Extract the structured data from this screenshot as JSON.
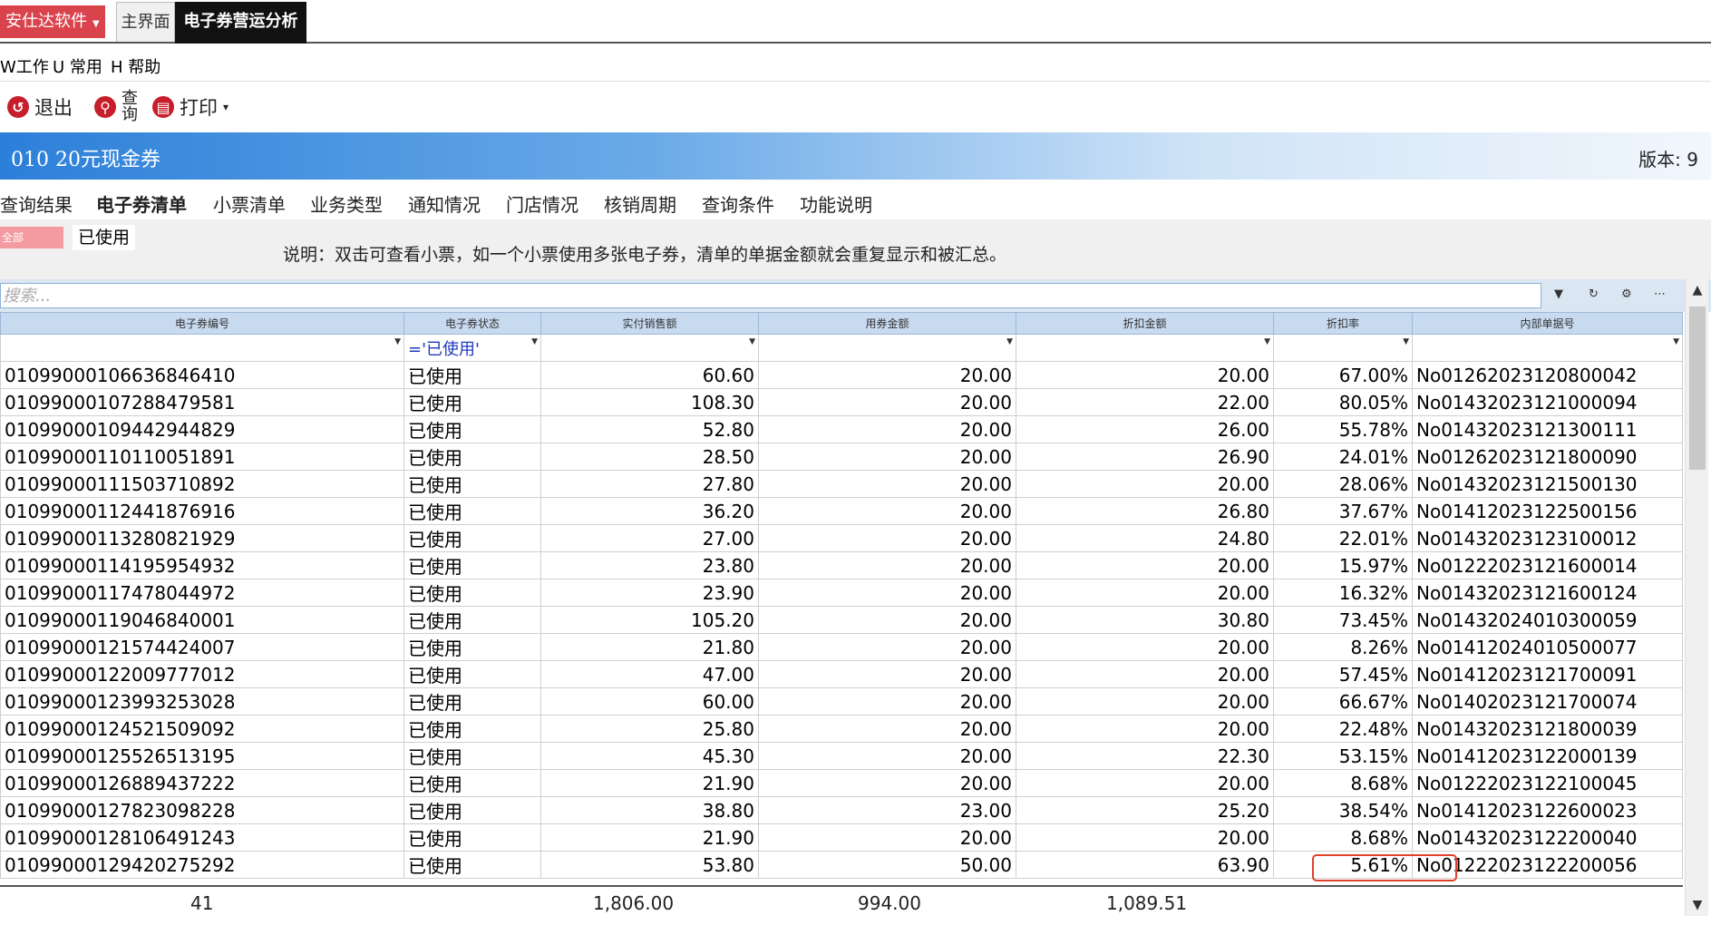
{
  "app_tabs": {
    "brand": "安仕达软件",
    "main": "主界面",
    "active": "电子券营运分析"
  },
  "menu": [
    "W工作",
    "U 常用",
    "H 帮助"
  ],
  "toolbar": {
    "exit_label": "退出",
    "query_label_top": "查",
    "query_label_bottom": "询",
    "print_label": "打印"
  },
  "title": {
    "text": "010  20元现金券",
    "version": "版本: 9"
  },
  "subtabs": [
    "查询结果",
    "电子券清单",
    "小票清单",
    "业务类型",
    "通知情况",
    "门店情况",
    "核销周期",
    "查询条件",
    "功能说明"
  ],
  "active_subtab": "电子券清单",
  "status_filter": {
    "all_label": "全部",
    "used_label": "已使用"
  },
  "note": "说明：双击可查看小票，如一个小票使用多张电子券，清单的单据金额就会重复显示和被汇总。",
  "search": {
    "placeholder": "搜索..."
  },
  "grid": {
    "columns": [
      "电子券编号",
      "电子券状态",
      "实付销售额",
      "用券金额",
      "折扣金额",
      "折扣率",
      "内部单据号"
    ],
    "filter_values": [
      "",
      "='已使用'",
      "",
      "",
      "",
      "",
      ""
    ],
    "rows": [
      [
        "010990001066368464​10",
        "已使用",
        "60.60",
        "20.00",
        "20.00",
        "67.00%",
        "No01262023120800042"
      ]
    ]
  },
  "totals": {
    "count": "41",
    "paid_sales": "1,806.00",
    "coupon_amount": "994.00",
    "discount_amount": "1,089.51"
  },
  "colors": {
    "brand_red": "#d9434c",
    "header_blue": "#c7daf0",
    "title_gradient_start": "#2c7fd9",
    "highlight_red": "#e0412a"
  }
}
